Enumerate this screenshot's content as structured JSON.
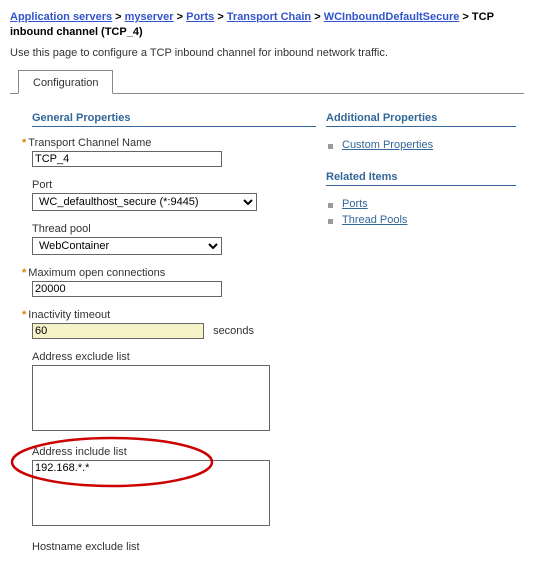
{
  "breadcrumb": {
    "items": [
      {
        "label": "Application servers"
      },
      {
        "label": "myserver"
      },
      {
        "label": "Ports"
      },
      {
        "label": "Transport Chain"
      },
      {
        "label": "WCInboundDefaultSecure"
      }
    ],
    "current": "TCP inbound channel (TCP_4)"
  },
  "description": "Use this page to configure a TCP inbound channel for inbound network traffic.",
  "tab": "Configuration",
  "section_general": "General Properties",
  "fields": {
    "transport_channel_name": {
      "label": "Transport Channel Name",
      "value": "TCP_4"
    },
    "port": {
      "label": "Port",
      "value": "WC_defaulthost_secure (*:9445)"
    },
    "thread_pool": {
      "label": "Thread pool",
      "value": "WebContainer"
    },
    "max_open": {
      "label": "Maximum open connections",
      "value": "20000"
    },
    "inactivity": {
      "label": "Inactivity timeout",
      "value": "60",
      "unit": "seconds"
    },
    "addr_exclude": {
      "label": "Address exclude list",
      "value": ""
    },
    "addr_include": {
      "label": "Address include list",
      "value": "192.168.*.*"
    },
    "host_exclude": {
      "label": "Hostname exclude list"
    }
  },
  "sidebar": {
    "additional_title": "Additional Properties",
    "additional_items": [
      "Custom Properties"
    ],
    "related_title": "Related Items",
    "related_items": [
      "Ports",
      "Thread Pools"
    ]
  }
}
